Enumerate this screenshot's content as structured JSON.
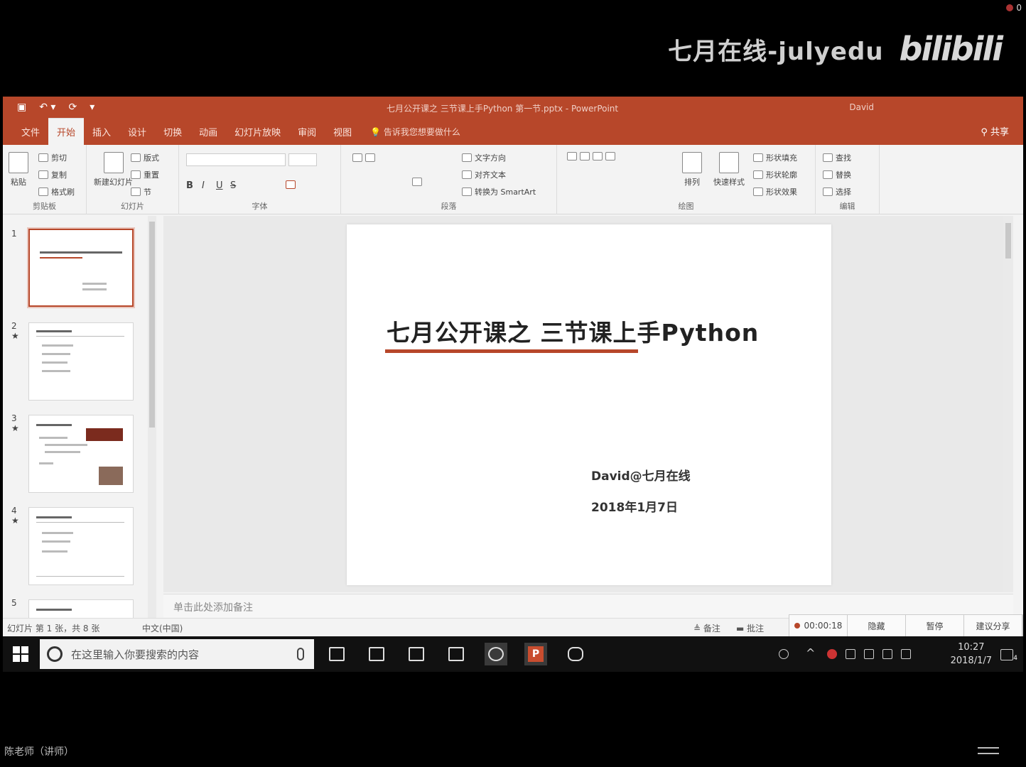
{
  "watermark": {
    "text": "七月在线-julyedu",
    "logo": "bilibili",
    "badge_count": "0"
  },
  "window": {
    "doc_title": "七月公开课之 三节课上手Python 第一节.pptx - PowerPoint",
    "user": "David",
    "qat": {
      "save_icon": "save-icon",
      "undo_icon": "undo-icon",
      "redo_icon": "redo-icon"
    }
  },
  "tabs": [
    "文件",
    "开始",
    "插入",
    "设计",
    "切换",
    "动画",
    "幻灯片放映",
    "审阅",
    "视图"
  ],
  "active_tab": "开始",
  "tell_me": "告诉我您想要做什么",
  "share": "共享",
  "ribbon": {
    "clipboard": {
      "paste": "粘贴",
      "cut": "剪切",
      "copy": "复制",
      "format_painter": "格式刷",
      "label": "剪贴板"
    },
    "slides": {
      "new_slide": "新建幻灯片",
      "layout": "版式",
      "reset": "重置",
      "section": "节",
      "label": "幻灯片"
    },
    "font": {
      "bold": "B",
      "italic": "I",
      "underline": "U",
      "strike": "S",
      "label": "字体"
    },
    "paragraph": {
      "text_direction": "文字方向",
      "align_text": "对齐文本",
      "smartart": "转换为 SmartArt",
      "label": "段落"
    },
    "drawing": {
      "arrange": "排列",
      "quick_styles": "快速样式",
      "fill": "形状填充",
      "outline": "形状轮廓",
      "effects": "形状效果",
      "label": "绘图"
    },
    "editing": {
      "find": "查找",
      "replace": "替换",
      "select": "选择",
      "label": "编辑"
    }
  },
  "thumbnails": [
    {
      "num": "1",
      "star": ""
    },
    {
      "num": "2",
      "star": "★"
    },
    {
      "num": "3",
      "star": "★"
    },
    {
      "num": "4",
      "star": "★"
    },
    {
      "num": "5",
      "star": ""
    }
  ],
  "slide": {
    "title": "七月公开课之 三节课上手Python",
    "author": "David@七月在线",
    "date": "2018年1月7日"
  },
  "notes_placeholder": "单击此处添加备注",
  "status": {
    "slide_count": "幻灯片 第 1 张，共 8 张",
    "language": "中文(中国)",
    "notes_btn": "备注",
    "comments_btn": "批注",
    "timer": "00:00:18",
    "btn_record": "隐藏",
    "btn_pause": "暂停",
    "btn_share": "建议分享"
  },
  "taskbar": {
    "search_placeholder": "在这里输入你要搜索的内容",
    "time": "10:27",
    "date": "2018/1/7",
    "notif_count": "4"
  },
  "bottom_label": "陈老师（讲师）",
  "colors": {
    "accent": "#b7472a",
    "taskbar": "#111111"
  }
}
